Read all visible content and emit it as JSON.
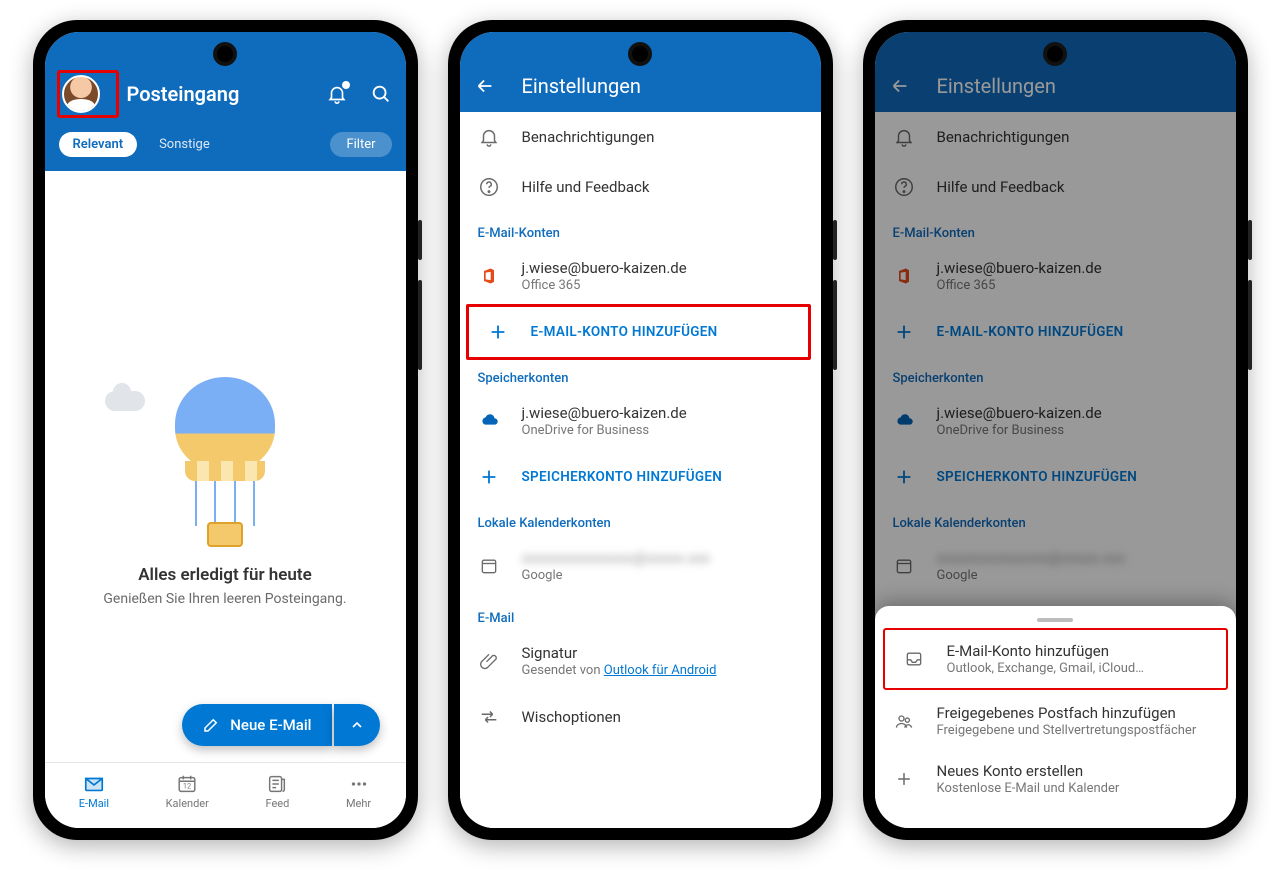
{
  "phone1": {
    "header": {
      "title": "Posteingang",
      "tab_relevant": "Relevant",
      "tab_other": "Sonstige",
      "filter": "Filter"
    },
    "empty": {
      "title": "Alles erledigt für heute",
      "sub": "Genießen Sie Ihren leeren Posteingang."
    },
    "fab": "Neue E-Mail",
    "nav": {
      "email": "E-Mail",
      "calendar": "Kalender",
      "feed": "Feed",
      "more": "Mehr"
    }
  },
  "phone2": {
    "header_title": "Einstellungen",
    "items": {
      "notifications": "Benachrichtigungen",
      "help": "Hilfe und Feedback"
    },
    "sections": {
      "email_accounts": "E-Mail-Konten",
      "storage_accounts": "Speicherkonten",
      "local_cal": "Lokale Kalenderkonten",
      "email": "E-Mail"
    },
    "account": {
      "addr": "j.wiese@buero-kaizen.de",
      "o365": "Office 365",
      "odb": "OneDrive for Business",
      "google": "Google"
    },
    "add_email": "E-MAIL-KONTO HINZUFÜGEN",
    "add_storage": "SPEICHERKONTO HINZUFÜGEN",
    "signature": {
      "label": "Signatur",
      "prefix": "Gesendet von ",
      "link": "Outlook für Android"
    },
    "swipe": "Wischoptionen"
  },
  "phone3": {
    "sheet": {
      "add_email_t": "E-Mail-Konto hinzufügen",
      "add_email_s": "Outlook, Exchange, Gmail, iCloud…",
      "shared_t": "Freigegebenes Postfach hinzufügen",
      "shared_s": "Freigegebene und Stellvertretungspostfächer",
      "new_t": "Neues Konto erstellen",
      "new_s": "Kostenlose E-Mail und Kalender"
    }
  }
}
